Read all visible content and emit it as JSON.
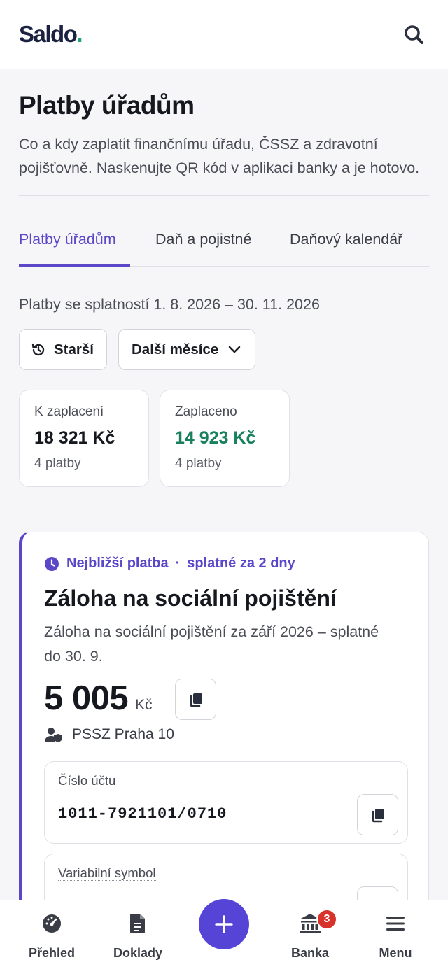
{
  "header": {
    "logo_text": "Saldo",
    "logo_dot": ".",
    "search_icon": "search-icon"
  },
  "page": {
    "title": "Platby úřadům",
    "lead": "Co a kdy zaplatit finančnímu úřadu, ČSSZ a zdravotní pojišťovně. Naskenujte QR kód v aplikaci banky a je hotovo."
  },
  "tabs": [
    {
      "label": "Platby úřadům",
      "active": true
    },
    {
      "label": "Daň a pojistné",
      "active": false
    },
    {
      "label": "Daňový kalendář",
      "active": false
    }
  ],
  "filter": {
    "range_text": "Platby se splatností 1. 8. 2026 – 30. 11. 2026",
    "older_label": "Starší",
    "more_months_label": "Další měsíce"
  },
  "stats": {
    "to_pay": {
      "label": "K zaplacení",
      "value": "18 321 Kč",
      "count": "4 platby"
    },
    "paid": {
      "label": "Zaplaceno",
      "value": "14 923 Kč",
      "count": "4 platby"
    }
  },
  "payment": {
    "tag": "Nejbližší platba",
    "separator": "·",
    "due": "splatné za 2 dny",
    "title": "Záloha na sociální pojištění",
    "description": "Záloha na sociální pojištění za září 2026 – splatné do 30. 9.",
    "amount": "5 005",
    "currency": "Kč",
    "recipient": "PSSZ Praha 10",
    "account_label": "Číslo účtu",
    "account_value": "1011-7921101/0710",
    "vs_label": "Variabilní symbol"
  },
  "nav": {
    "overview": "Přehled",
    "documents": "Doklady",
    "bank": "Banka",
    "bank_badge": "3",
    "menu": "Menu"
  },
  "colors": {
    "accent": "#5b48c9",
    "fab": "#5644d6",
    "positive": "#17805c",
    "badge": "#d8332b",
    "logo": "#1b2240"
  }
}
